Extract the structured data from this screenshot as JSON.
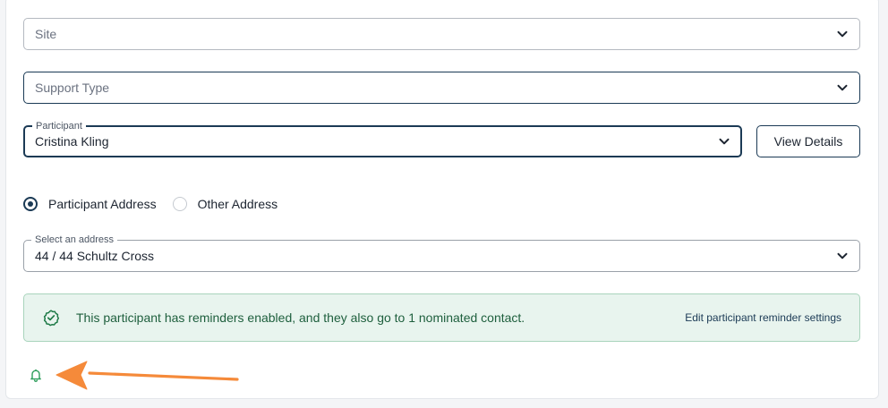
{
  "fields": {
    "site": {
      "placeholder": "Site"
    },
    "support_type": {
      "placeholder": "Support Type"
    },
    "participant": {
      "label": "Participant",
      "value": "Cristina Kling"
    },
    "address": {
      "label": "Select an address",
      "value": "44 / 44 Schultz Cross"
    }
  },
  "buttons": {
    "view_details": "View Details"
  },
  "address_options": [
    {
      "label": "Participant Address",
      "selected": true
    },
    {
      "label": "Other Address",
      "selected": false
    }
  ],
  "reminder_banner": {
    "message": "This participant has reminders enabled, and they also go to 1 nominated contact.",
    "link": "Edit participant reminder settings"
  },
  "colors": {
    "primary": "#1b3a55",
    "success_bg": "#e8f4ee",
    "success_text": "#1e5f3d",
    "annotation_arrow": "#f58a3a",
    "bell": "#2e9e5b"
  },
  "icons": [
    "chevron-down-icon",
    "check-circle-icon",
    "bell-icon"
  ]
}
